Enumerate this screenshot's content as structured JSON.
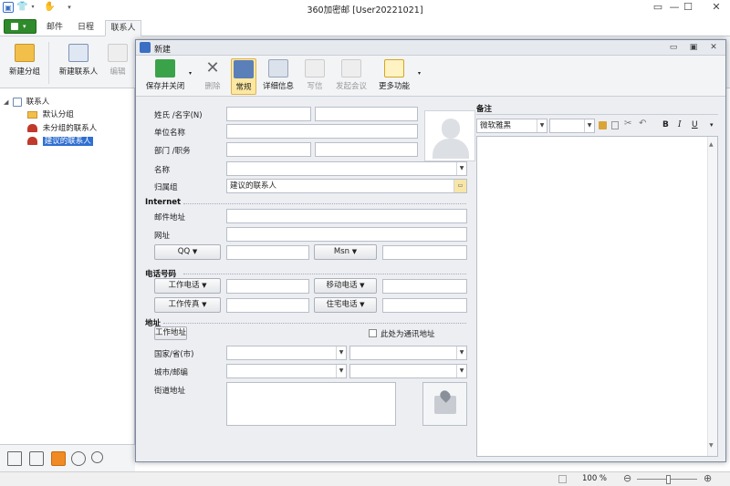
{
  "app": {
    "title": "360加密邮 [User20221021]",
    "tabs": [
      {
        "label": "邮件"
      },
      {
        "label": "日程"
      },
      {
        "label": "联系人"
      }
    ]
  },
  "ribbon": {
    "new_group": "新建分组",
    "new_contact": "新建联系人",
    "edit": "编辑"
  },
  "tree": {
    "root": "联系人",
    "items": [
      {
        "label": "默认分组"
      },
      {
        "label": "未分组的联系人"
      },
      {
        "label": "建议的联系人"
      }
    ]
  },
  "status": {
    "zoom": "100 %"
  },
  "dialog": {
    "title": "新建",
    "toolbar": {
      "save_close": "保存并关闭",
      "delete": "删除",
      "general": "常规",
      "details": "详细信息",
      "write": "写信",
      "meeting": "发起会议",
      "more": "更多功能"
    },
    "form": {
      "name_label": "姓氏 /名字(N)",
      "company_label": "单位名称",
      "dept_label": "部门 /职务",
      "display_name_label": "名称",
      "group_label": "归属组",
      "group_value": "建议的联系人",
      "internet_heading": "Internet",
      "email_label": "邮件地址",
      "website_label": "网址",
      "qq_button": "QQ",
      "msn_button": "Msn",
      "phone_heading": "电话号码",
      "work_phone_button": "工作电话",
      "mobile_button": "移动电话",
      "work_fax_button": "工作传真",
      "home_phone_button": "住宅电话",
      "address_heading": "地址",
      "work_address_button": "工作地址",
      "mailing_address_check": "此处为通讯地址",
      "country_label": "国家/省(市)",
      "city_label": "城市/邮编",
      "street_label": "街道地址"
    },
    "notes": {
      "heading": "备注",
      "font": "微软雅黑",
      "bold": "B",
      "italic": "I",
      "underline": "U"
    }
  }
}
